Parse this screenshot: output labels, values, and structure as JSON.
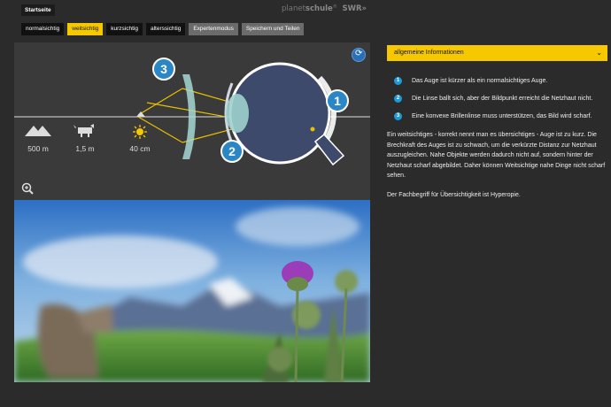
{
  "topbar": {
    "home_label": "Startseite",
    "brand_planet": "planet",
    "brand_schule": "schule",
    "brand_sup": "®",
    "brand_swr": "SWR»"
  },
  "nav": {
    "tabs": [
      {
        "label": "normalsichtig"
      },
      {
        "label": "weitsichtig"
      },
      {
        "label": "kurzsichtig"
      },
      {
        "label": "alterssichtig"
      },
      {
        "label": "Expertenmodus"
      },
      {
        "label": "Speichern und Teilen"
      }
    ]
  },
  "diagram": {
    "distances": [
      "500 m",
      "1,5 m",
      "40 cm"
    ],
    "badges": [
      "1",
      "2",
      "3"
    ]
  },
  "panel": {
    "select_value": "allgemeine Informationen",
    "items": [
      {
        "num": "1",
        "text": "Das Auge ist kürzer als ein normalsichtiges Auge."
      },
      {
        "num": "2",
        "text": "Die Linse ballt sich, aber der Bildpunkt erreicht die Netzhaut nicht."
      },
      {
        "num": "3",
        "text": "Eine konvexe Brillenlinse muss unterstützen, das Bild wird scharf."
      }
    ],
    "para1": "Ein weitsichtiges - korrekt nennt man es übersichtiges - Auge ist zu kurz. Die Brechkraft des Auges ist zu schwach, um die verkürzte Distanz zur Netzhaut auszugleichen. Nahe Objekte werden dadurch nicht auf, sondern hinter der Netzhaut scharf abgebildet. Daher können Weitsichtige nahe Dinge nicht scharf sehen.",
    "para2": "Der Fachbegriff für Übersichtigkeit ist Hyperopie."
  },
  "colors": {
    "accent": "#f5c800",
    "badge_blue": "#2b86c5",
    "background": "#2b2b2b"
  }
}
